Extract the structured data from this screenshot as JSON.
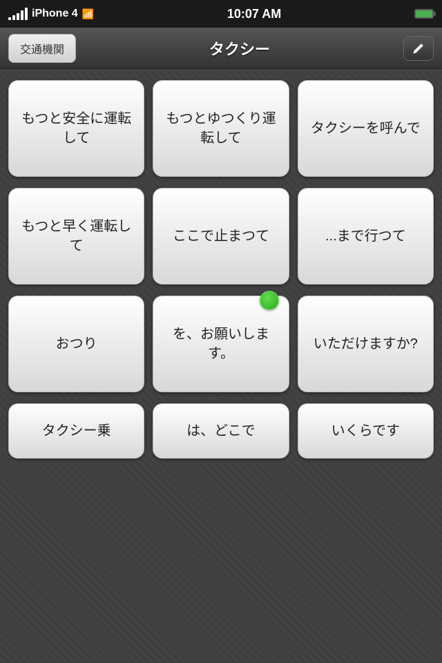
{
  "statusBar": {
    "carrier": "iPhone 4",
    "time": "10:07 AM",
    "wifi": "📶"
  },
  "navBar": {
    "backLabel": "交通機関",
    "title": "タクシー",
    "editIcon": "✏"
  },
  "grid": [
    [
      {
        "id": "btn-safe-drive",
        "text": "もつと安全に運転して"
      },
      {
        "id": "btn-slow-drive",
        "text": "もつとゆつくり運転して"
      },
      {
        "id": "btn-call-taxi",
        "text": "タクシーを呼んで"
      }
    ],
    [
      {
        "id": "btn-fast-drive",
        "text": "もつと早く運転して"
      },
      {
        "id": "btn-stop-here",
        "text": "ここで止まつて"
      },
      {
        "id": "btn-go-to",
        "text": "...まで行つて"
      }
    ],
    [
      {
        "id": "btn-change",
        "text": "おつり",
        "hasDot": true
      },
      {
        "id": "btn-please",
        "text": "を、お願いします。"
      },
      {
        "id": "btn-may-i",
        "text": "いただけますか?"
      }
    ],
    [
      {
        "id": "btn-taxi-ride",
        "text": "タクシー乗"
      },
      {
        "id": "btn-where",
        "text": "は、どこで"
      },
      {
        "id": "btn-how-much",
        "text": "いくらです"
      }
    ]
  ]
}
